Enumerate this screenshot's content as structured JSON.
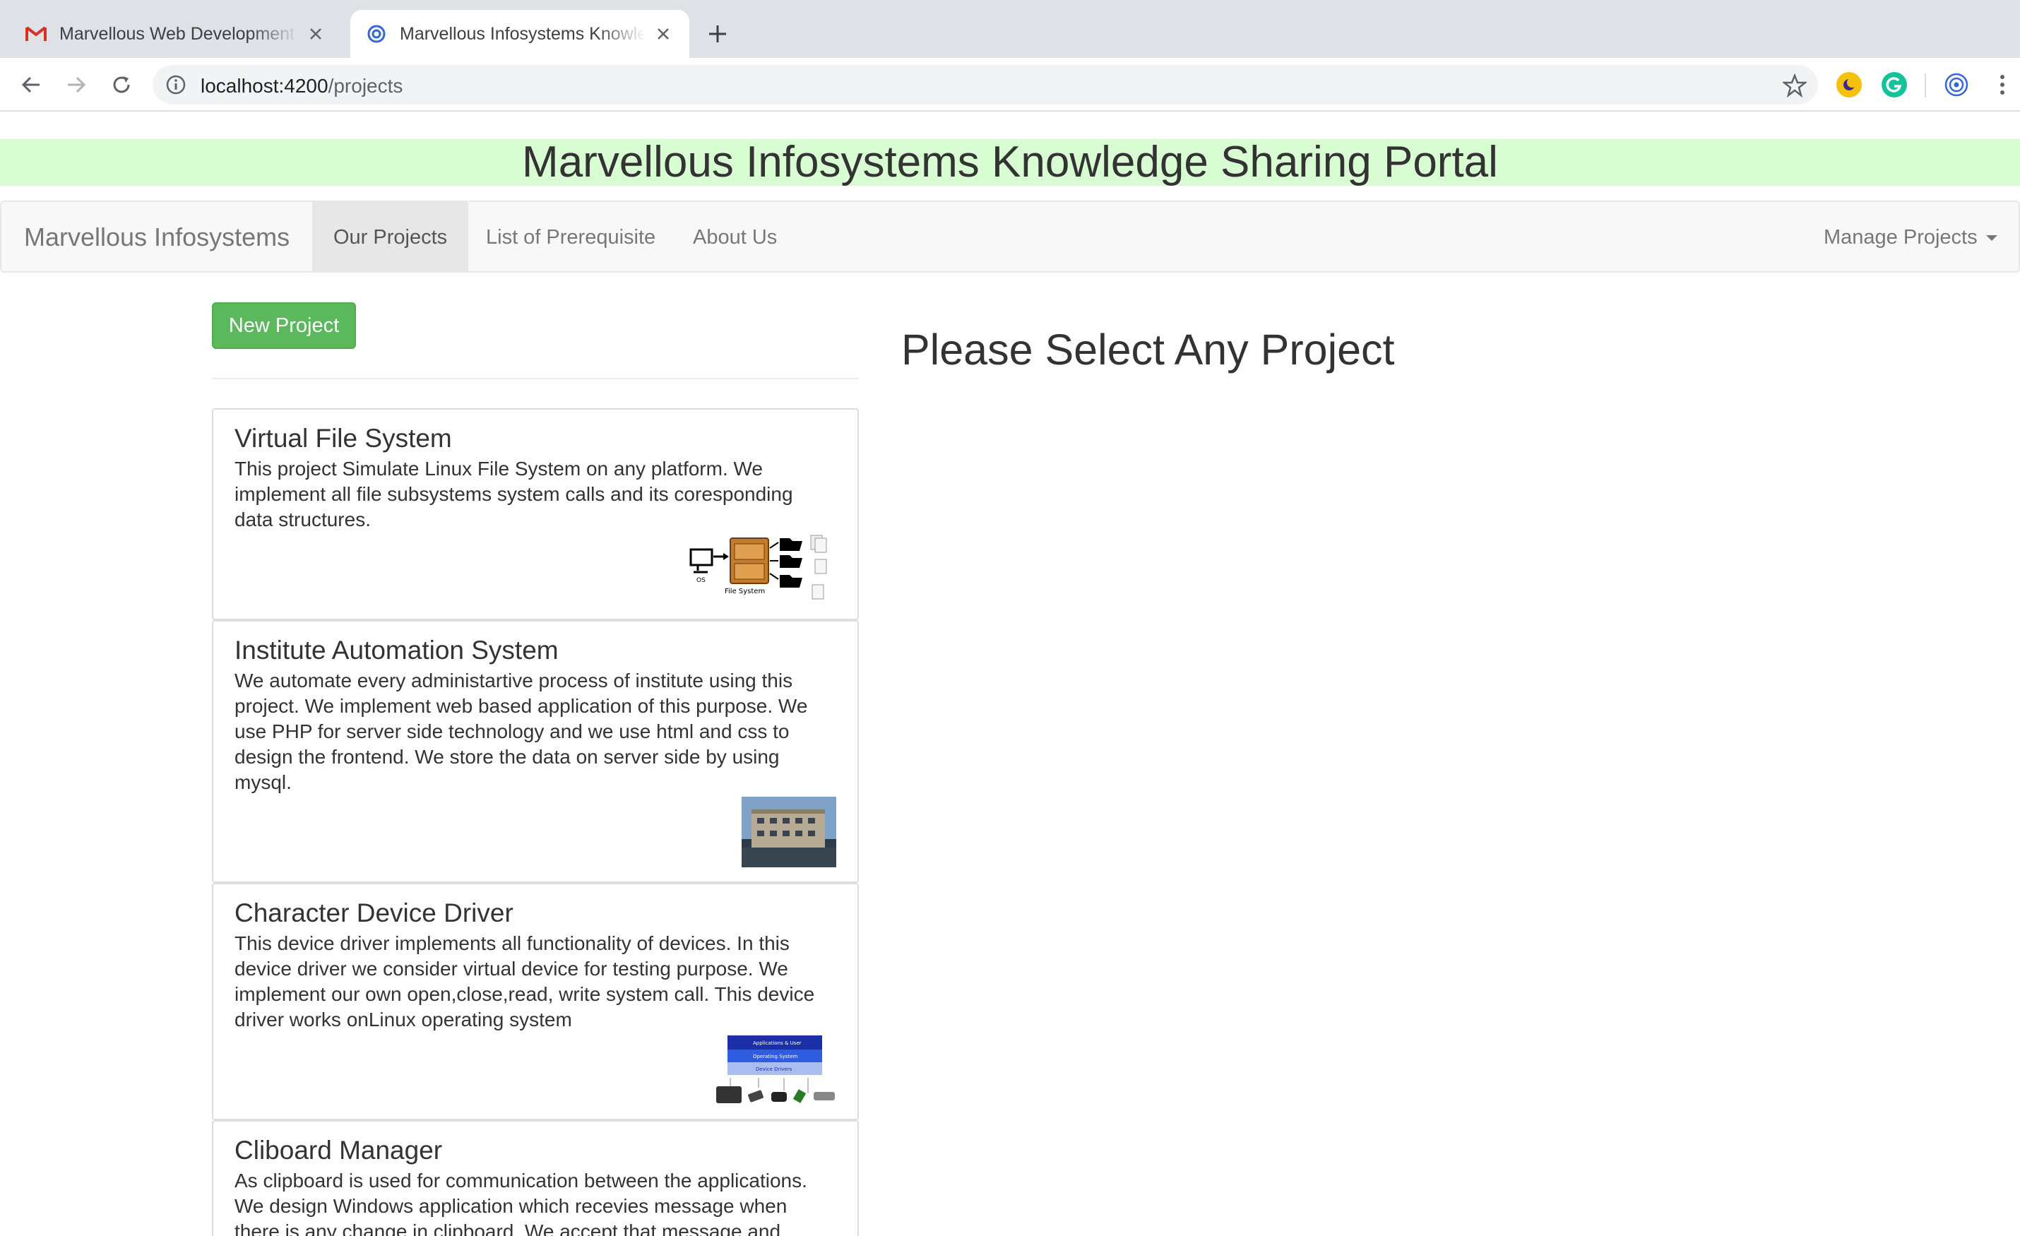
{
  "browser": {
    "tabs": [
      {
        "title": "Marvellous Web Development",
        "icon": "gmail-icon",
        "active": false
      },
      {
        "title": "Marvellous Infosystems Knowledge Sharing Portal",
        "icon": "angular-icon",
        "active": true
      }
    ],
    "url_host": "localhost:4200",
    "url_path": "/projects"
  },
  "page": {
    "banner_title": "Marvellous Infosystems Knowledge Sharing Portal",
    "navbar": {
      "brand": "Marvellous Infosystems",
      "links": [
        "Our Projects",
        "List of Prerequisite",
        "About Us"
      ],
      "active_link": "Our Projects",
      "dropdown": "Manage Projects"
    },
    "new_project_label": "New Project",
    "select_heading": "Please Select Any Project",
    "projects": [
      {
        "name": "Virtual File System",
        "description": "This project Simulate Linux File System on any platform. We implement all file subsystems system calls and its coresponding data structures.",
        "image": "file-system-diagram",
        "image_labels": [
          "OS",
          "File System"
        ]
      },
      {
        "name": "Institute Automation System",
        "description": "We automate every administartive process of institute using this project. We implement web based application of this purpose. We use PHP for server side technology and we use html and css to design the frontend. We store the data on server side by using mysql.",
        "image": "building-photo"
      },
      {
        "name": "Character Device Driver",
        "description": "This device driver implements all functionality of devices. In this device driver we consider virtual device for testing purpose. We implement our own open,close,read, write system call. This device driver works onLinux operating system",
        "image": "device-driver-diagram",
        "image_labels": [
          "Applications & User",
          "Operating System",
          "Device Drivers"
        ]
      },
      {
        "name": "Cliboard Manager",
        "description": "As clipboard is used for communication between the applications. We design Windows application which recevies message when there is any change in clipboard. We accept that message and",
        "image": ""
      }
    ]
  },
  "colors": {
    "banner_bg": "#d9fdd3",
    "success_button": "#5cb85c"
  }
}
